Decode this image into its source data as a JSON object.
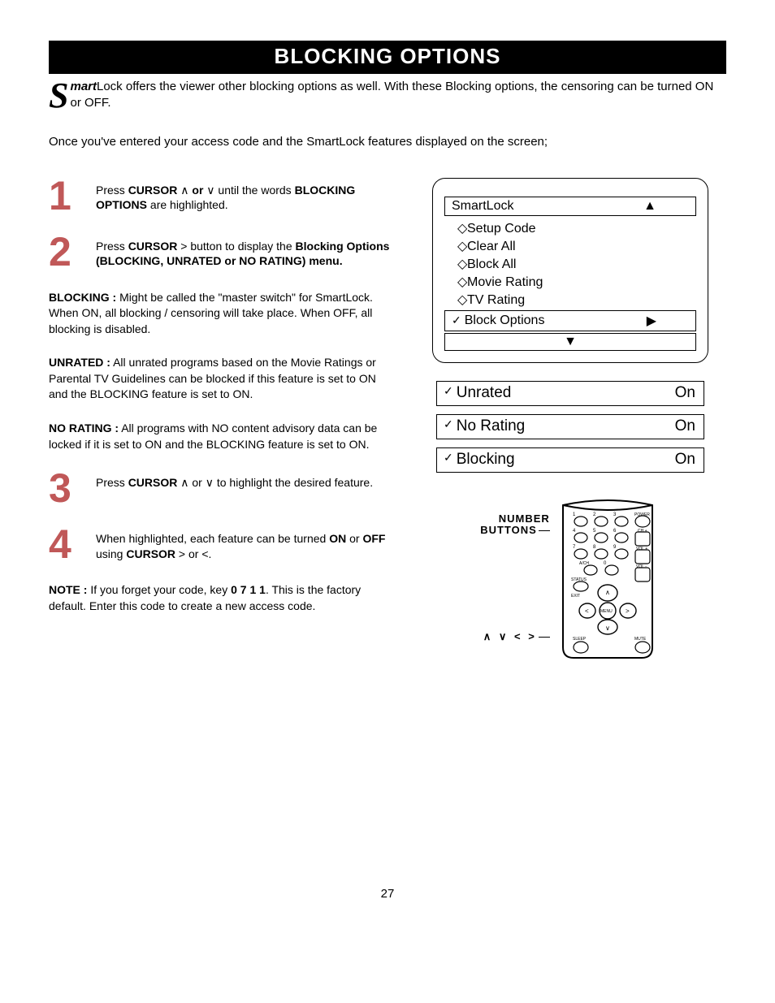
{
  "title": "BLOCKING OPTIONS",
  "intro_dropcap": "S",
  "intro_prefix": "mart",
  "intro_rest": "Lock offers the viewer other blocking options as well.  With these Blocking options, the censoring can be turned ON or OFF.",
  "subintro": "Once you've entered your access code and the SmartLock features displayed on the screen;",
  "steps": {
    "s1": {
      "num": "1",
      "a": "Press ",
      "b": "CURSOR",
      "c": " ∧ ",
      "d": "or",
      "e": " ∨ until the words ",
      "f": "BLOCKING OPTIONS",
      "g": " are highlighted."
    },
    "s2": {
      "num": "2",
      "a": "Press ",
      "b": "CURSOR",
      "c": " > button to display the ",
      "d": "Blocking Options (BLOCKING, UNRATED or NO RATING) menu."
    },
    "s3": {
      "num": "3",
      "a": "Press ",
      "b": "CURSOR",
      "c": " ∧ or ∨  to highlight the desired feature."
    },
    "s4": {
      "num": "4",
      "a": "When highlighted, each feature can be turned ",
      "b": "ON",
      "c": " or ",
      "d": "OFF",
      "e": " using ",
      "f": "CURSOR",
      "g": " > or <."
    }
  },
  "defs": {
    "blocking_label": "BLOCKING :",
    "blocking_text": " Might be called the \"master switch\" for SmartLock. When ON, all blocking / censoring will take place. When OFF, all blocking is disabled.",
    "unrated_label": "UNRATED :",
    "unrated_text": " All unrated programs based on the Movie Ratings or Parental TV Guidelines can be blocked if this feature is set to ON and the BLOCKING feature is set to ON.",
    "norating_label": "NO RATING :",
    "norating_text": " All programs with NO content advisory data can be locked if it is set to ON and the BLOCKING feature is set to ON."
  },
  "note": {
    "label": "NOTE :",
    "a": " If you forget your code, key ",
    "b": "0 7 1 1",
    "c": ". This is the factory default.  Enter this code to create a new access code."
  },
  "osd": {
    "title": "SmartLock",
    "items": [
      "Setup Code",
      "Clear All",
      "Block All",
      "Movie Rating",
      "TV Rating"
    ],
    "selected": "Block Options"
  },
  "options": [
    {
      "label": "Unrated",
      "value": "On"
    },
    {
      "label": "No Rating",
      "value": "On"
    },
    {
      "label": "Blocking",
      "value": "On"
    }
  ],
  "remote": {
    "label1a": "NUMBER",
    "label1b": "BUTTONS",
    "label2": "∧ ∨ < >"
  },
  "page_number": "27"
}
